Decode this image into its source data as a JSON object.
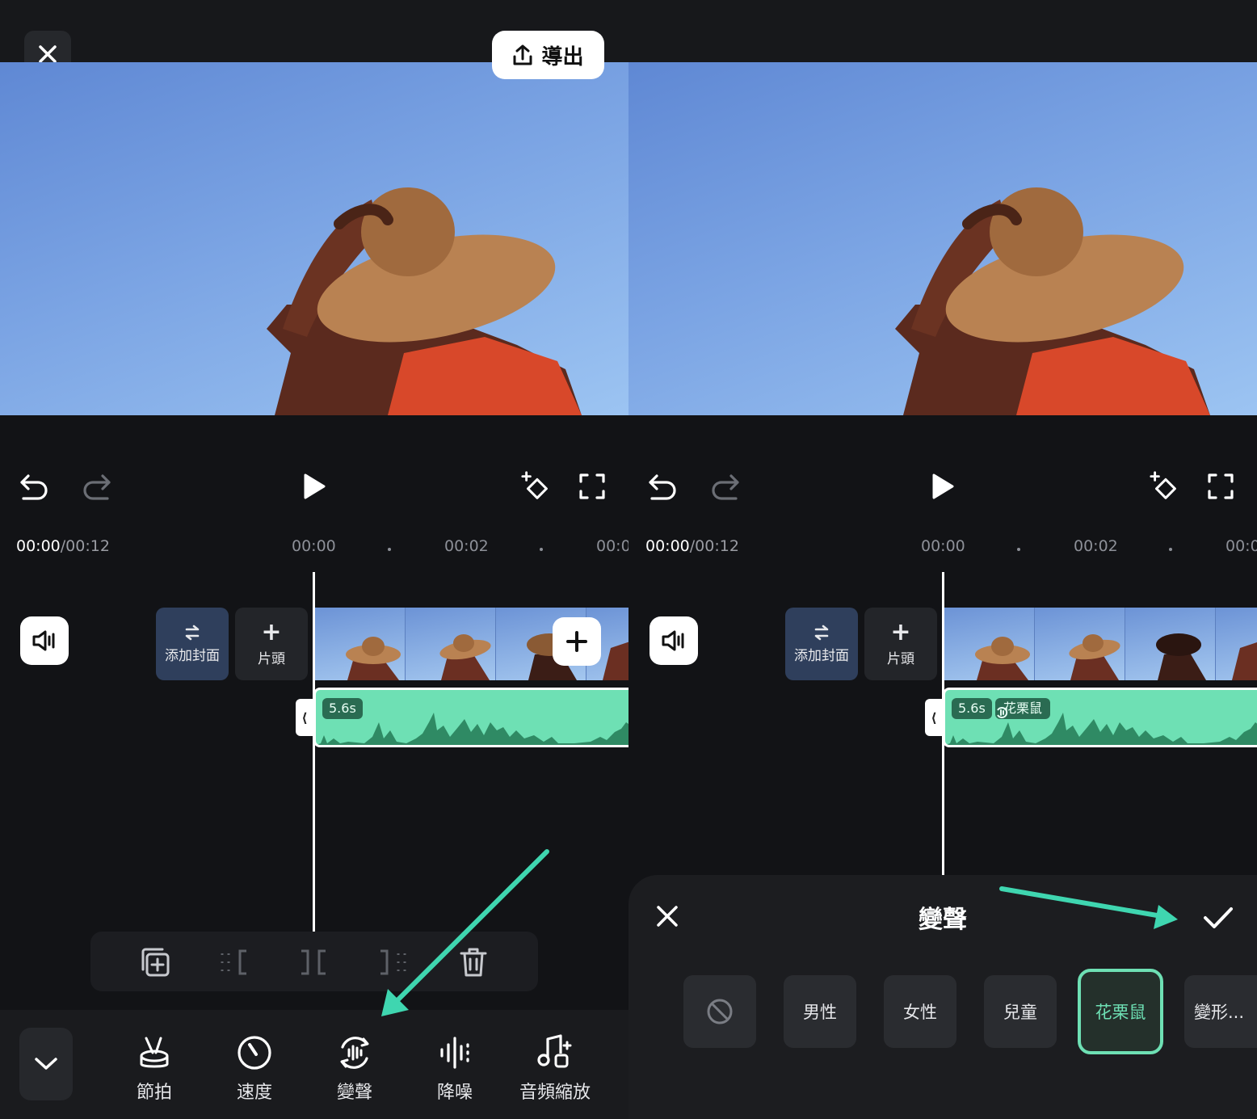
{
  "export_button": {
    "label": "導出"
  },
  "timeline": {
    "current_time": "00:00",
    "total_time": "/00:12",
    "ticks": [
      "00:00",
      "00:02",
      "00:0"
    ]
  },
  "track": {
    "cover_label": "添加封面",
    "intro_label": "片頭",
    "audio_duration": "5.6s",
    "voice_effect_tag": "花栗鼠"
  },
  "bottom_tools": [
    {
      "label": "節拍",
      "icon": "beat-icon"
    },
    {
      "label": "速度",
      "icon": "speed-icon"
    },
    {
      "label": "變聲",
      "icon": "voice-changer-icon"
    },
    {
      "label": "降噪",
      "icon": "noise-reduction-icon"
    },
    {
      "label": "音頻縮放",
      "icon": "audio-zoom-icon"
    }
  ],
  "voice_sheet": {
    "title": "變聲",
    "options": [
      "男性",
      "女性",
      "兒童",
      "花栗鼠",
      "變形..."
    ],
    "selected": "花栗鼠"
  },
  "colors": {
    "accent": "#6ee0b4",
    "arrow": "#3fd6b0",
    "sky": "#7aa3e3"
  }
}
